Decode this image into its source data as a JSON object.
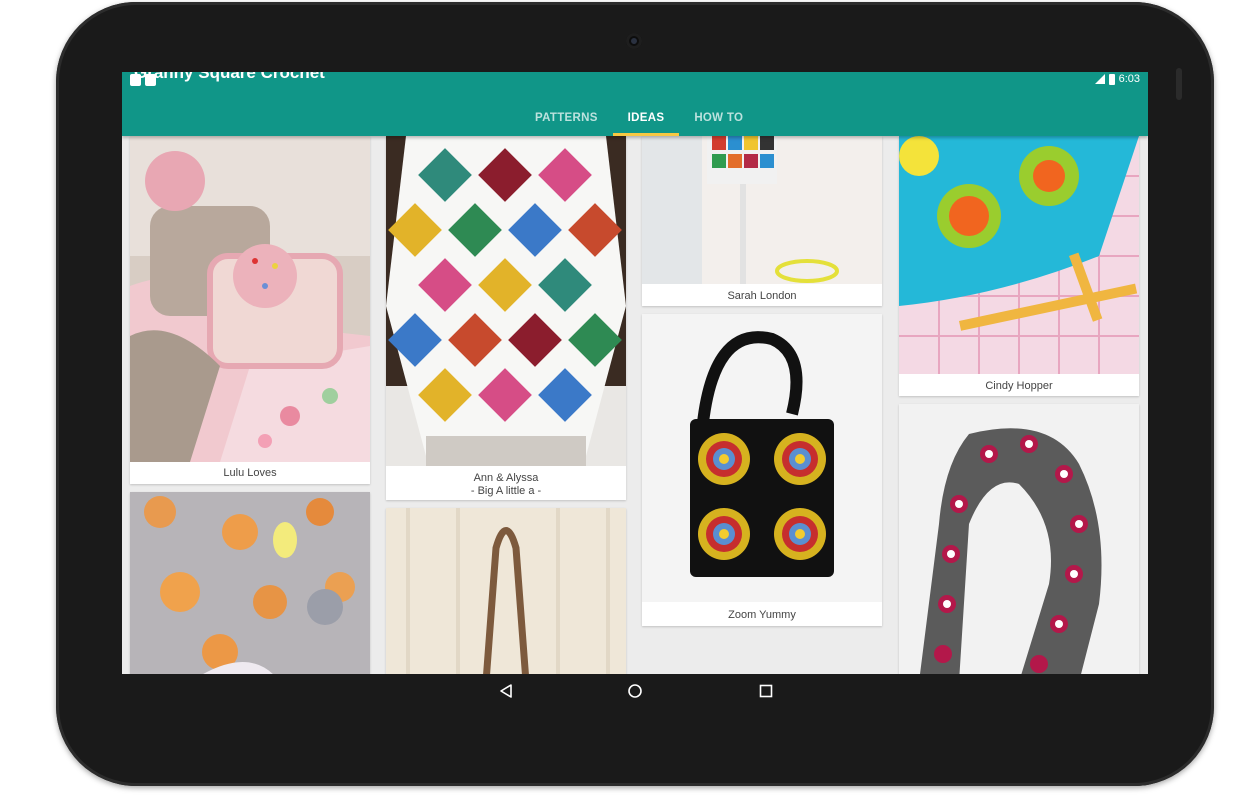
{
  "app": {
    "title": "Granny Square Crochet",
    "status_time": "6:03"
  },
  "tabs": [
    {
      "label": "PATTERNS",
      "active": false
    },
    {
      "label": "IDEAS",
      "active": true
    },
    {
      "label": "HOW TO",
      "active": false
    }
  ],
  "cards": {
    "lulu": {
      "caption": "Lulu Loves"
    },
    "ann": {
      "caption_line1": "Ann & Alyssa",
      "caption_line2": "- Big A little a -"
    },
    "sarah": {
      "caption": "Sarah London"
    },
    "zoom": {
      "caption": "Zoom Yummy"
    },
    "cindy": {
      "caption": "Cindy Hopper"
    },
    "floral": {
      "caption": ""
    },
    "strap": {
      "caption": ""
    },
    "scarf": {
      "caption": ""
    }
  },
  "colors": {
    "accent": "#109688",
    "tab_indicator": "#f7c843",
    "screen_bg": "#ececec"
  },
  "icons": [
    "back-icon",
    "home-icon",
    "recents-icon",
    "signal-icon",
    "battery-icon"
  ]
}
